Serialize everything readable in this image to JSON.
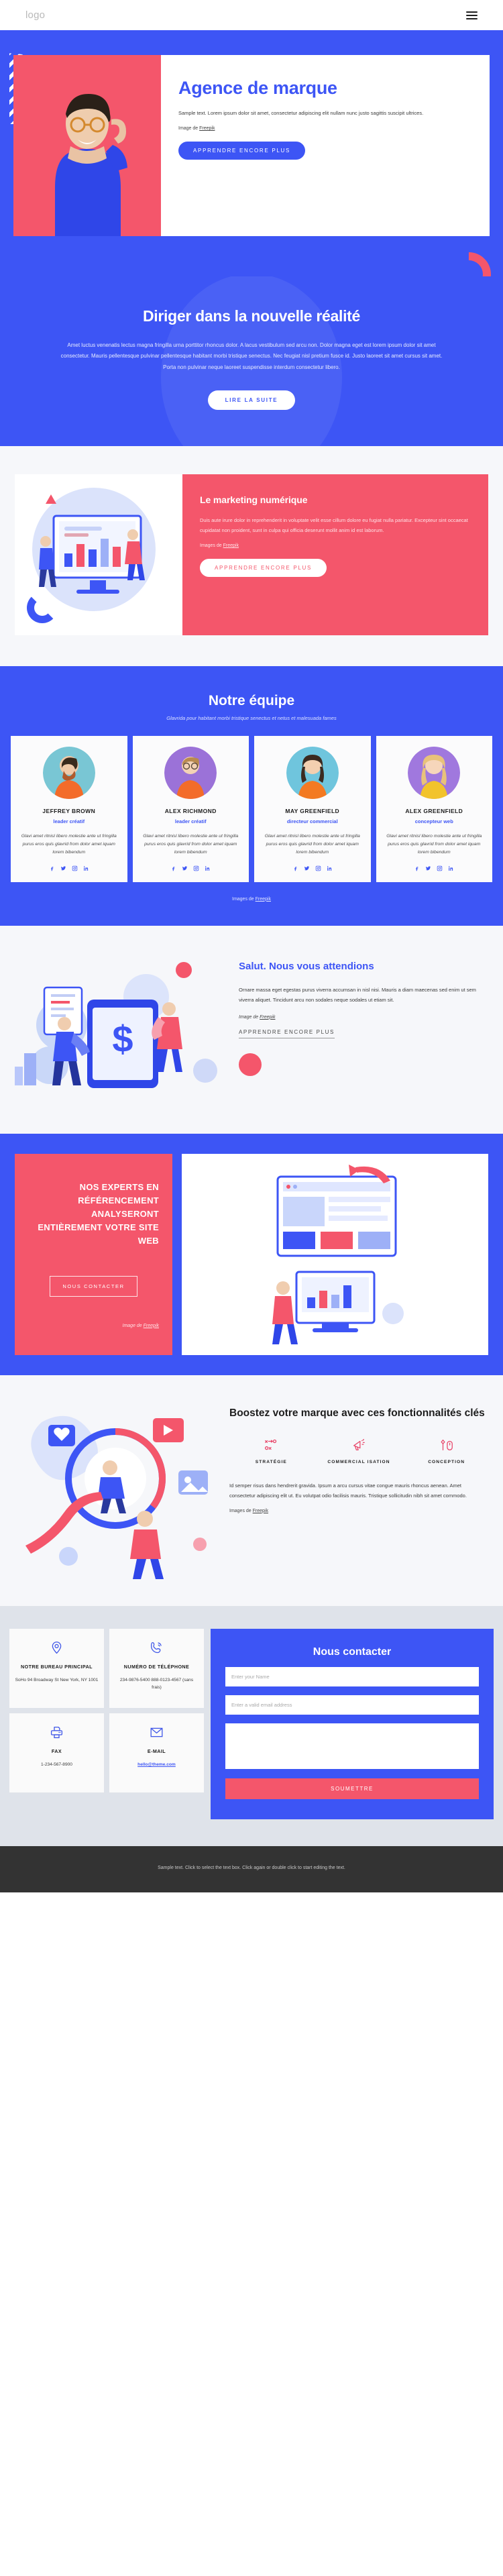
{
  "header": {
    "logo": "logo",
    "menu_icon": "hamburger-icon"
  },
  "hero": {
    "title": "Agence de marque",
    "subtitle": "Sample text. Lorem ipsum dolor sit amet, consectetur adipiscing elit nullam nunc justo sagittis suscipit ultrices.",
    "credit_prefix": "Image de ",
    "credit_link": "Freepik",
    "cta": "APPRENDRE ENCORE PLUS"
  },
  "lead": {
    "title": "Diriger dans la nouvelle réalité",
    "body": "Amet luctus venenatis lectus magna fringilla urna porttitor rhoncus dolor. A lacus vestibulum sed arcu non. Dolor magna eget est lorem ipsum dolor sit amet consectetur. Mauris pellentesque pulvinar pellentesque habitant morbi tristique senectus. Nec feugiat nisl pretium fusce id. Justo laoreet sit amet cursus sit amet. Porta non pulvinar neque laoreet suspendisse interdum consectetur libero.",
    "cta": "LIRE LA SUITE"
  },
  "marketing": {
    "title": "Le marketing numérique",
    "body": "Duis aute irure dolor in reprehenderit in voluptate velit esse cillum dolore eu fugiat nulla pariatur. Excepteur sint occaecat cupidatat non proident, sunt in culpa qui officia deserunt mollit anim id est laborum.",
    "credit_prefix": "Images de ",
    "credit_link": "Freepik",
    "cta": "APPRENDRE ENCORE PLUS"
  },
  "team": {
    "title": "Notre équipe",
    "tagline": "Glavrida pour habitant morbi tristique senectus et netus et malesuada fames",
    "credit_prefix": "Images de ",
    "credit_link": "Freepik",
    "members": [
      {
        "name": "JEFFREY BROWN",
        "role": "leader créatif",
        "bio": "Glavi amet ritnisl libero molestie ante ut fringilla purus eros quis glavrid from dolor amet iquam lorem bibendum"
      },
      {
        "name": "ALEX RICHMOND",
        "role": "leader créatif",
        "bio": "Glavi amet ritnisl libero molestie ante ut fringilla purus eros quis glavrid from dolor amet iquam lorem bibendum"
      },
      {
        "name": "MAY GREENFIELD",
        "role": "directeur commercial",
        "bio": "Glavi amet ritnisl libero molestie ante ut fringilla purus eros quis glavrid from dolor amet iquam lorem bibendum"
      },
      {
        "name": "ALEX GREENFIELD",
        "role": "concepteur web",
        "bio": "Glavi amet ritnisl libero molestie ante ut fringilla purus eros quis glavrid from dolor amet iquam lorem bibendum"
      }
    ]
  },
  "salut": {
    "title": "Salut. Nous vous attendions",
    "body": "Ornare massa eget egestas purus viverra accumsan in nisl nisi. Mauris a diam maecenas sed enim ut sem viverra aliquet. Tincidunt arcu non sodales neque sodales ut etiam sit.",
    "credit_prefix": "Image de ",
    "credit_link": "Freepik",
    "cta": "APPRENDRE ENCORE PLUS"
  },
  "seo": {
    "title": "NOS EXPERTS EN RÉFÉRENCEMENT ANALYSERONT ENTIÈREMENT VOTRE SITE WEB",
    "cta": "NOUS CONTACTER",
    "credit_prefix": "Image de ",
    "credit_link": "Freepik"
  },
  "features": {
    "title": "Boostez votre marque avec ces fonctionnalités clés",
    "items": [
      {
        "label": "STRATÉGIE",
        "icon": "strategy-icon"
      },
      {
        "label": "COMMERCIAL ISATION",
        "icon": "megaphone-icon"
      },
      {
        "label": "CONCEPTION",
        "icon": "design-mouse-icon"
      }
    ],
    "body": "Id semper risus dans hendrerit gravida. Ipsum a arcu cursus vitae congue mauris rhoncus aenean. Amet consectetur adipiscing elit ut. Eu volutpat odio facilisis mauris. Tristique sollicitudin nibh sit amet commodo.",
    "credit_prefix": "Images de ",
    "credit_link": "Freepik"
  },
  "contact": {
    "info": [
      {
        "icon": "map-pin-icon",
        "title": "NOTRE BUREAU PRINCIPAL",
        "value": "SoHo 94 Broadway St New York, NY 1001"
      },
      {
        "icon": "phone-icon",
        "title": "NUMÉRO DE TÉLÉPHONE",
        "value": "234-9876-5400 888-0123-4567 (sans frais)"
      },
      {
        "icon": "fax-icon",
        "title": "FAX",
        "value": "1-234-567-8900"
      },
      {
        "icon": "envelope-icon",
        "title": "E-MAIL",
        "value": "hello@theme.com",
        "is_link": true
      }
    ],
    "form": {
      "title": "Nous contacter",
      "name_placeholder": "Enter your Name",
      "name_value": "",
      "email_placeholder": "Enter a valid email address",
      "email_value": "",
      "message_placeholder": "",
      "message_value": "",
      "submit": "SOUMETTRE"
    }
  },
  "footer": {
    "text": "Sample text. Click to select the text box. Click again or double click to start editing the text."
  },
  "colors": {
    "blue": "#3d55f5",
    "pink": "#f4566b",
    "dark": "#333333",
    "light": "#f6f7fa",
    "grey": "#dfe3ea"
  }
}
